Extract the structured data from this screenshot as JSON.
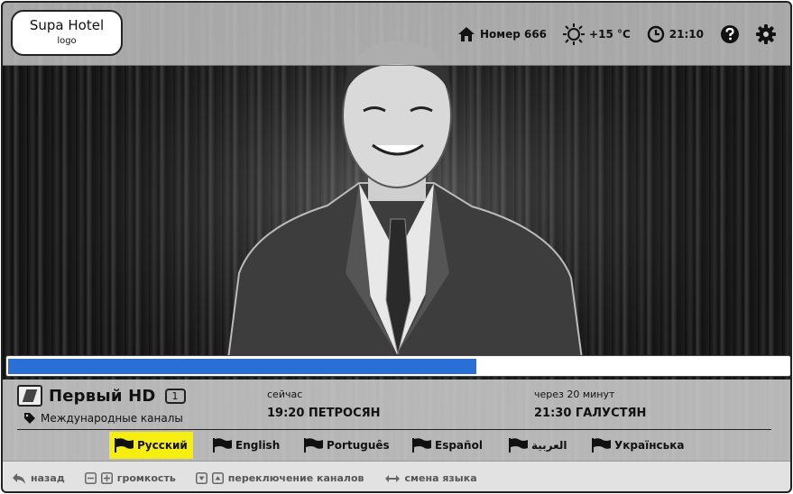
{
  "hotel": {
    "name": "Supa Hotel",
    "logo_caption": "logo"
  },
  "status": {
    "room_label": "Номер 666",
    "weather_label": "+15 °C",
    "time_label": "21:10"
  },
  "playback": {
    "progress_fraction": 0.6
  },
  "channel": {
    "name": "Первый HD",
    "number": "1",
    "category": "Международные каналы"
  },
  "schedule": {
    "now": {
      "when": "сейчас",
      "title": "19:20 ПЕТРОСЯН"
    },
    "next": {
      "when": "через 20 минут",
      "title": "21:30 ГАЛУСТЯН"
    }
  },
  "languages": [
    {
      "label": "Русский",
      "active": true
    },
    {
      "label": "English",
      "active": false
    },
    {
      "label": "Português",
      "active": false
    },
    {
      "label": "Español",
      "active": false
    },
    {
      "label": "العربية",
      "active": false
    },
    {
      "label": "Українська",
      "active": false
    }
  ],
  "help": {
    "back": "назад",
    "volume": "громкость",
    "channel_switch": "переключение каналов",
    "language_switch": "смена языка"
  },
  "colors": {
    "progress": "#2a6fd6",
    "active_language": "#f5ee10"
  },
  "icons": [
    "home-icon",
    "sun-icon",
    "clock-icon",
    "help-icon",
    "gear-icon",
    "tag-icon",
    "flag-icon",
    "back-arrow-icon",
    "minus-key-icon",
    "plus-key-icon",
    "down-key-icon",
    "up-key-icon",
    "left-right-arrow-icon"
  ]
}
